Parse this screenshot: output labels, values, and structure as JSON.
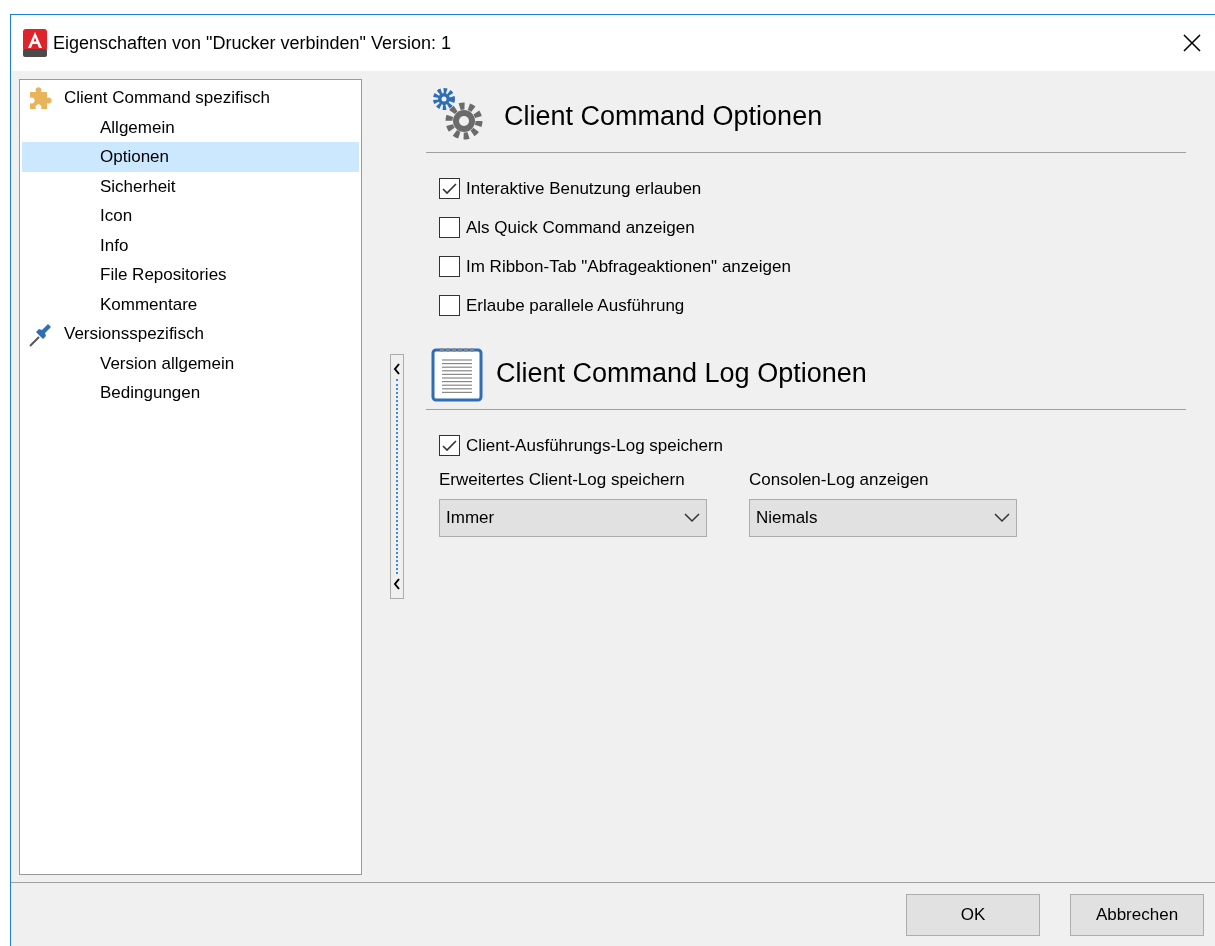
{
  "window": {
    "title": "Eigenschaften von \"Drucker verbinden\" Version: 1"
  },
  "tree": [
    {
      "label": "Client Command spezifisch",
      "selected": false,
      "children": [
        {
          "label": "Allgemein",
          "selected": false
        },
        {
          "label": "Optionen",
          "selected": true
        },
        {
          "label": "Sicherheit",
          "selected": false
        },
        {
          "label": "Icon",
          "selected": false
        },
        {
          "label": "Info",
          "selected": false
        },
        {
          "label": "File Repositories",
          "selected": false
        },
        {
          "label": "Kommentare",
          "selected": false
        }
      ]
    },
    {
      "label": "Versionsspezifisch",
      "selected": false,
      "children": [
        {
          "label": "Version allgemein",
          "selected": false
        },
        {
          "label": "Bedingungen",
          "selected": false
        }
      ]
    }
  ],
  "sections": [
    {
      "title": "Client Command Optionen",
      "checkboxes": [
        {
          "label": "Interaktive Benutzung erlauben",
          "checked": true
        },
        {
          "label": "Als Quick Command anzeigen",
          "checked": false
        },
        {
          "label": "Im Ribbon-Tab \"Abfrageaktionen\" anzeigen",
          "checked": false
        },
        {
          "label": "Erlaube parallele Ausführung",
          "checked": false
        }
      ]
    },
    {
      "title": "Client Command Log Optionen",
      "checkboxes": [
        {
          "label": "Client-Ausführungs-Log speichern",
          "checked": true
        }
      ],
      "dropdowns": [
        {
          "label": "Erweitertes Client-Log speichern",
          "value": "Immer"
        },
        {
          "label": "Consolen-Log anzeigen",
          "value": "Niemals"
        }
      ]
    }
  ],
  "buttons": [
    "OK",
    "Abbrechen"
  ]
}
